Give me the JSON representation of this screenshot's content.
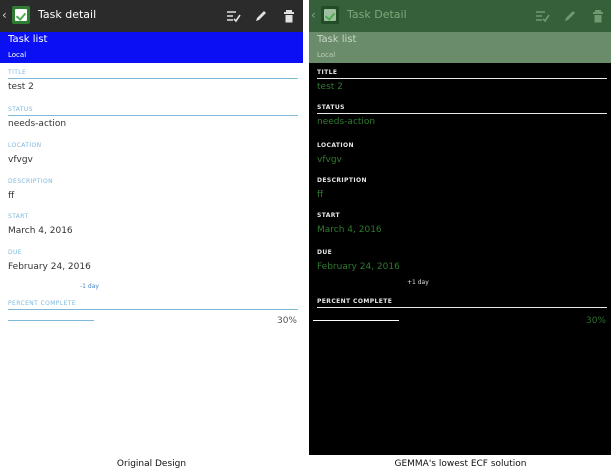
{
  "panels": {
    "original": {
      "app_title": "Task detail",
      "header_title": "Task list",
      "header_sub": "Local",
      "fields": [
        {
          "label": "TITLE",
          "value": "test 2"
        },
        {
          "label": "STATUS",
          "value": "needs-action"
        },
        {
          "label": "LOCATION",
          "value": "vfvgv"
        },
        {
          "label": "DESCRIPTION",
          "value": "ff"
        },
        {
          "label": "START",
          "value": "March 4, 2016"
        },
        {
          "label": "DUE",
          "value": "February 24, 2016"
        }
      ],
      "due_relative": "-1 day",
      "percent_label": "PERCENT COMPLETE",
      "percent_value": "30%"
    },
    "solution": {
      "app_title": "Task Detail",
      "header_title": "Task list",
      "header_sub": "Local",
      "fields": [
        {
          "label": "TITLE",
          "value": "test 2"
        },
        {
          "label": "STATUS",
          "value": "needs-action"
        },
        {
          "label": "LOCATION",
          "value": "vfvgv"
        },
        {
          "label": "DESCRIPTION",
          "value": "ff"
        },
        {
          "label": "START",
          "value": "March 4, 2016"
        },
        {
          "label": "DUE",
          "value": "February 24, 2016"
        }
      ],
      "due_relative": "+1 day",
      "percent_label": "PERCENT COMPLETE",
      "percent_value": "30%"
    }
  },
  "captions": {
    "left": "Original Design",
    "right": "GEMMA's lowest ECF solution"
  },
  "colors": {
    "original_appbar": "#2b2b2b",
    "original_header": "#0a10f3",
    "original_accent": "#7eb8db",
    "solution_appbar": "#35603a",
    "solution_header": "#6a8c6a",
    "solution_value": "#2f7a2f",
    "solution_background": "#000000"
  },
  "icons": {
    "app": "task-app-icon",
    "toolbar": [
      "checklist-icon",
      "pencil-icon",
      "trash-icon"
    ]
  }
}
